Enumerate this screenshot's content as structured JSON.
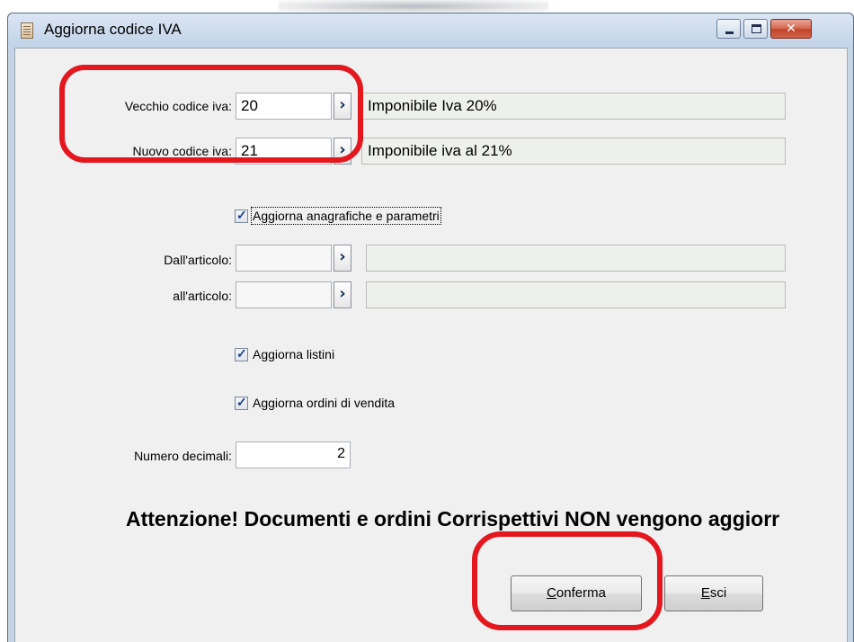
{
  "window": {
    "title": "Aggiorna codice IVA",
    "controls": {
      "minimize_icon": "minimize-icon",
      "maximize_icon": "maximize-icon",
      "close_glyph": "✕"
    }
  },
  "form": {
    "vecchio": {
      "label": "Vecchio codice iva:",
      "value": "20",
      "description": "Imponibile Iva 20%"
    },
    "nuovo": {
      "label": "Nuovo codice iva:",
      "value": "21",
      "description": "Imponibile iva al 21%"
    },
    "aggiorna_anagrafiche": {
      "label": "Aggiorna anagrafiche e parametri",
      "checked": true
    },
    "dall_articolo": {
      "label": "Dall'articolo:",
      "value": "",
      "description": ""
    },
    "all_articolo": {
      "label": "all'articolo:",
      "value": "",
      "description": ""
    },
    "aggiorna_listini": {
      "label": "Aggiorna listini",
      "checked": true
    },
    "aggiorna_ordini": {
      "label": "Aggiorna ordini di vendita",
      "checked": true
    },
    "numero_decimali": {
      "label": "Numero decimali:",
      "value": "2"
    }
  },
  "warning": "Attenzione! Documenti e ordini Corrispettivi NON vengono aggiorr",
  "buttons": {
    "conferma": {
      "accel": "C",
      "rest": "onferma"
    },
    "esci": {
      "accel": "E",
      "rest": "sci"
    }
  },
  "colors": {
    "highlight": "#e4161e",
    "title_bar": "#cddcee",
    "dialog_bg": "#f0f0f0"
  }
}
